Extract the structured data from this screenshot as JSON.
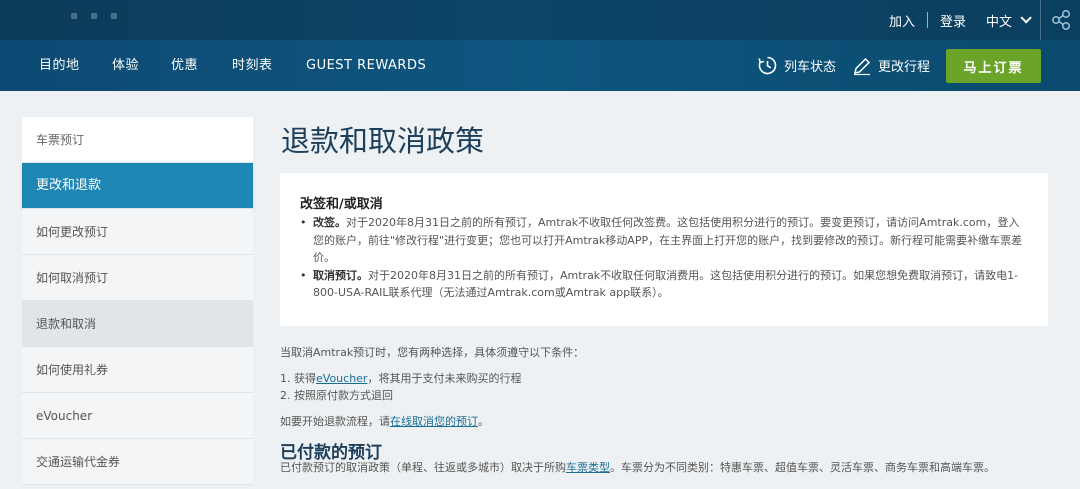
{
  "topbar": {
    "join": "加入",
    "login": "登录",
    "language": "中文"
  },
  "nav": {
    "items": [
      "目的地",
      "体验",
      "优惠",
      "时刻表",
      "GUEST REWARDS"
    ],
    "train_status": "列车状态",
    "modify_trip": "更改行程",
    "book_now": "马上订票"
  },
  "sidebar": {
    "items": [
      "车票预订",
      "更改和退款",
      "如何更改预订",
      "如何取消预订",
      "退款和取消",
      "如何使用礼券",
      "eVoucher",
      "交通运输代金券"
    ]
  },
  "content": {
    "title": "退款和取消政策",
    "box": {
      "heading": "改签和/或取消",
      "change_label": "改签。",
      "change_text": "对于2020年8月31日之前的所有预订，Amtrak不收取任何改签费。这包括使用积分进行的预订。要变更预订，请访问Amtrak.com，登入您的账户，前往\"修改行程\"进行变更；您也可以打开Amtrak移动APP，在主界面上打开您的账户，找到要修改的预订。新行程可能需要补缴车票差价。",
      "cancel_label": "取消预订。",
      "cancel_text": "对于2020年8月31日之前的所有预订，Amtrak不收取任何取消费用。这包括使用积分进行的预订。如果您想免费取消预订，请致电1-800-USA-RAIL联系代理（无法通过Amtrak.com或Amtrak app联系）。"
    },
    "intro": "当取消Amtrak预订时，您有两种选择，具体须遵守以下条件：",
    "option1_prefix": "1. 获得",
    "option1_link": "eVoucher",
    "option1_suffix": "，将其用于支付未来购买的行程",
    "option2": "2. 按照原付款方式退回",
    "start_prefix": "如要开始退款流程，请",
    "start_link": "在线取消您的预订",
    "start_suffix": "。",
    "paid_heading": "已付款的预订",
    "paid_prefix": "已付款预订的取消政策（单程、往返或多城市）取决于所购",
    "paid_link": "车票类型",
    "paid_suffix": "。车票分为不同类别：特惠车票、超值车票、灵活车票、商务车票和高端车票。"
  },
  "colors": {
    "topbar": "#0d3b5a",
    "navbar": "#0d567f",
    "book_button": "#6aa52a",
    "active_side": "#1e86b3",
    "title": "#1d3f5c",
    "link": "#1a6e96"
  },
  "icons": [
    "share-icon",
    "clock-icon",
    "pencil-icon",
    "chevron-down-icon"
  ]
}
